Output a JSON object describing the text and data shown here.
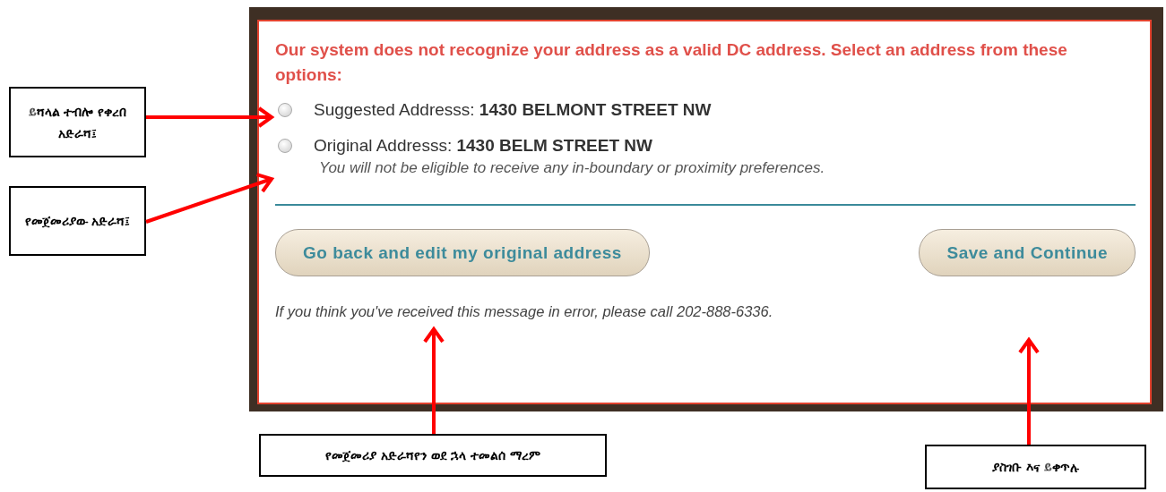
{
  "dialog": {
    "message": "Our system does not recognize your address as a valid DC address. Select an address from these options:",
    "options": [
      {
        "label": "Suggested Addresss: **1430 BELMONT STREET NW**",
        "selected": false
      },
      {
        "label": "Original Addresss: **1430 BELM STREET NW**",
        "note": "You will not be eligible to receive any in-boundary or proximity preferences.",
        "selected": false
      }
    ],
    "buttons": [
      "Go back and edit my original address",
      "Save and Continue"
    ],
    "footer": "If you think you've received this message in error, please call 202-888-6336."
  },
  "callouts": [
    {
      "text": "ይሻላል ተብሎ የቀረበ አድራሻ፤"
    },
    {
      "text": "የመጀመሪያው አድራሻ፤"
    },
    {
      "text": "የመጀመሪያ አድራሻየን ወደ ኋላ ተመልሰ ማረም"
    },
    {
      "text": "ያስገቡ እና ይቀጥሉ"
    }
  ]
}
